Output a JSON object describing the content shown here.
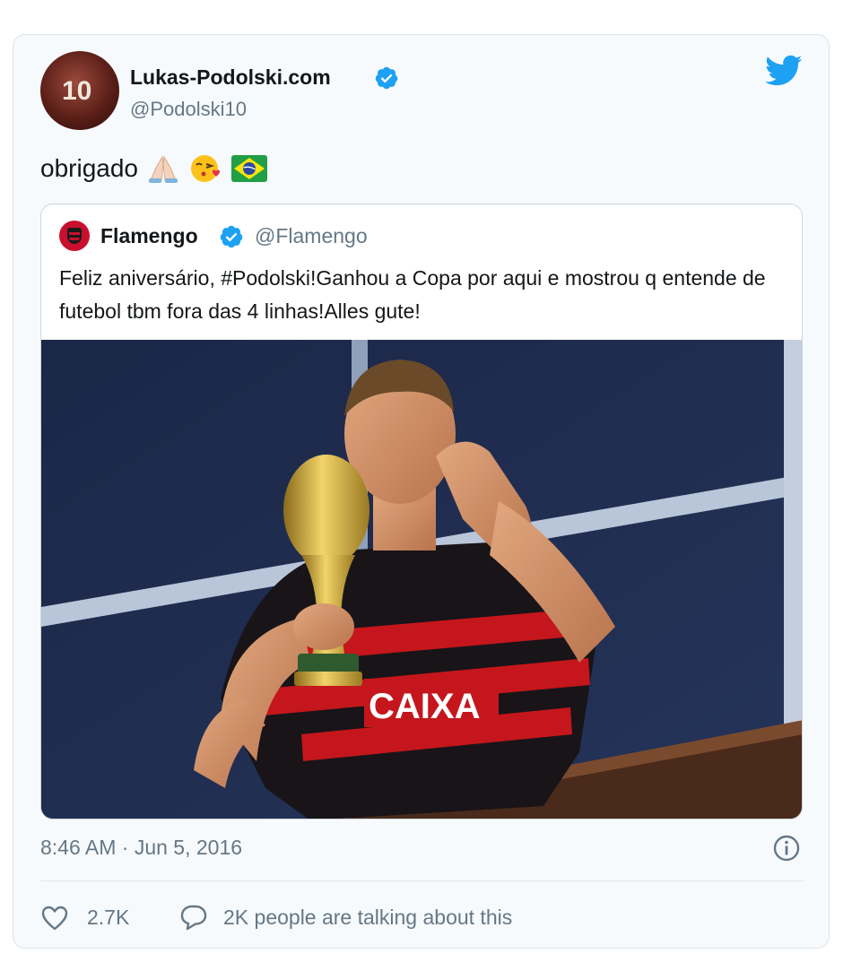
{
  "tweet": {
    "author": {
      "name": "Lukas-Podolski.com",
      "handle": "@Podolski10",
      "avatar_jersey_number": "10"
    },
    "text": "obrigado",
    "emojis": [
      "folded-hands-icon",
      "face-blowing-kiss-icon",
      "brazil-flag-icon"
    ],
    "timestamp": "8:46 AM · Jun 5, 2016",
    "likes": "2.7K",
    "talking": "2K people are talking about this"
  },
  "quoted_tweet": {
    "name": "Flamengo",
    "handle": "@Flamengo",
    "text": "Feliz aniversário, #Podolski!Ganhou a Copa por aqui e mostrou q entende de futebol tbm fora das 4 linhas!Alles gute!",
    "image": {
      "shirt_sponsor": "CAIXA"
    }
  },
  "icons": {
    "verified": "verified-badge-icon",
    "twitter": "twitter-bird-icon",
    "info": "info-icon",
    "like": "heart-icon",
    "reply": "speech-bubble-icon"
  },
  "colors": {
    "verified_blue": "#1da1f2",
    "secondary_text": "#657786",
    "flamengo_red": "#c8102e"
  }
}
